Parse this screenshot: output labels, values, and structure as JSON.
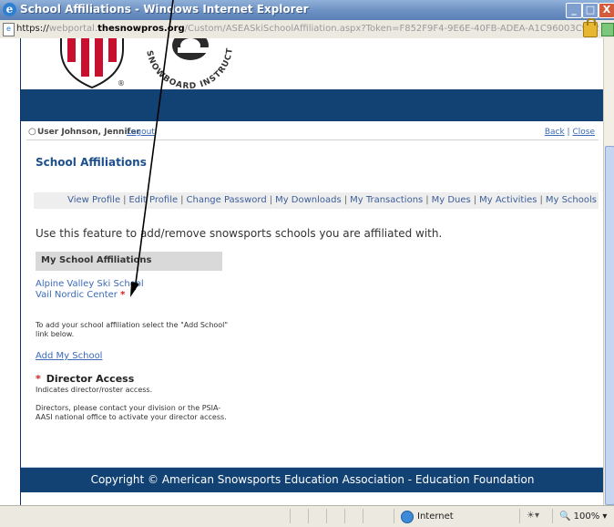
{
  "window": {
    "title": "School Affiliations - Windows Internet Explorer",
    "min_glyph": "_",
    "max_glyph": "□",
    "close_glyph": "X"
  },
  "address": {
    "scheme": "https://",
    "subdomain": "webportal.",
    "domain": "thesnowpros.org",
    "path": "/Custom/ASEASkiSchoolAffiliation.aspx?Token=F852F9F4-9E6E-40FB-ADEA-A1C96003C9E2"
  },
  "header": {
    "logo_arc_text": "SNOWBOARD INSTRUCTORS",
    "registered_mark": "®"
  },
  "userbar": {
    "user_icon": "person-icon",
    "user_label": "User Johnson, Jennifer",
    "logout_label": "Logout",
    "back_label": "Back",
    "close_label": "Close",
    "separator": "|"
  },
  "page": {
    "title": "School Affiliations",
    "intro": "Use this feature to add/remove snowsports schools you are affiliated with."
  },
  "nav": {
    "items": [
      "View Profile",
      "Edit Profile",
      "Change Password",
      "My Downloads",
      "My Transactions",
      "My Dues",
      "My Activities",
      "My Schools"
    ]
  },
  "affiliations": {
    "header": "My School Affiliations",
    "schools": [
      {
        "name": "Alpine Valley Ski School",
        "director": false
      },
      {
        "name": "Vail Nordic Center",
        "director": true
      }
    ],
    "star": "*",
    "instructions": "To add your school affiliation select the \"Add School\" link below.",
    "add_link": "Add My School"
  },
  "director": {
    "star": "*",
    "title": "Director Access",
    "desc": "Indicates director/roster access.",
    "note": "Directors, please contact your division or the PSIA-AASI national office to activate your director access."
  },
  "footer": {
    "text": "Copyright © American Snowsports Education Association - Education Foundation"
  },
  "status": {
    "zone": "Internet",
    "zoom": "100%"
  },
  "colors": {
    "navy": "#124173",
    "link": "#3a6ab8",
    "title": "#1c4f8c",
    "star": "#d31f1f",
    "shield_red": "#c8102e"
  }
}
